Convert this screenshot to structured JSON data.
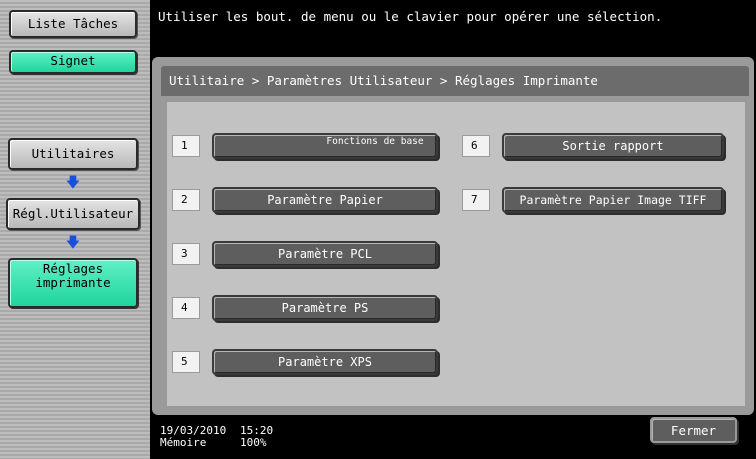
{
  "sidebar": {
    "task_list": "Liste Tâches",
    "bookmark": "Signet",
    "nav": [
      "Utilitaires",
      "Régl.Utilisateur",
      "Réglages imprimante"
    ]
  },
  "message": "Utiliser les bout. de menu ou le clavier pour opérer une sélection.",
  "breadcrumb": "Utilitaire > Paramètres Utilisateur > Réglages Imprimante",
  "menu": [
    {
      "num": "1",
      "label": "Fonctions de base"
    },
    {
      "num": "2",
      "label": "Paramètre Papier"
    },
    {
      "num": "3",
      "label": "Paramètre PCL"
    },
    {
      "num": "4",
      "label": "Paramètre PS"
    },
    {
      "num": "5",
      "label": "Paramètre XPS"
    },
    {
      "num": "6",
      "label": "Sortie rapport"
    },
    {
      "num": "7",
      "label": "Paramètre Papier Image TIFF"
    }
  ],
  "status": {
    "date": "19/03/2010",
    "time": "15:20",
    "memory_label": "Mémoire",
    "memory_value": "100%"
  },
  "close_label": "Fermer",
  "colors": {
    "accent_green": "#2ee0a8",
    "button_dark": "#5e5e5e",
    "arrow_blue": "#1a4fd8"
  }
}
